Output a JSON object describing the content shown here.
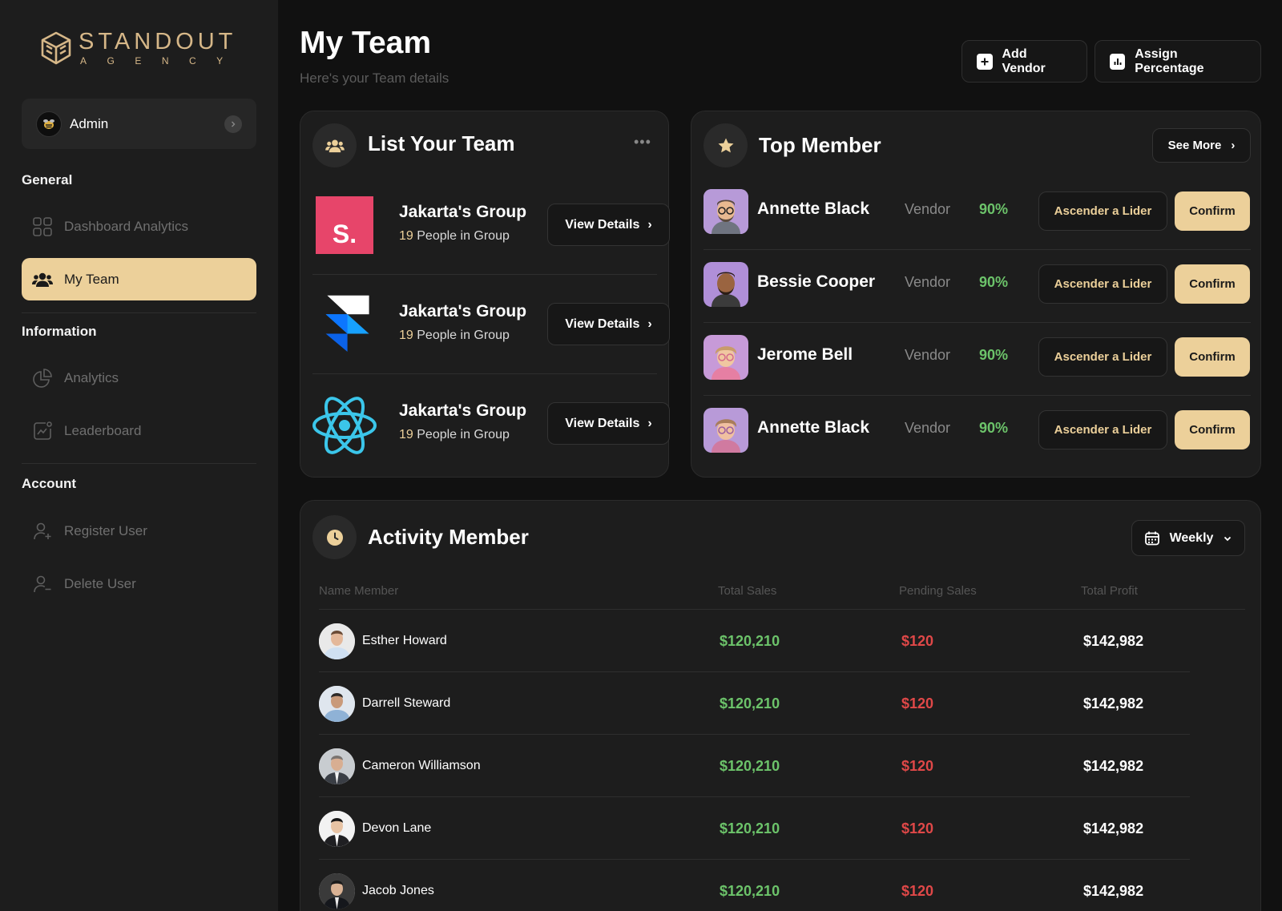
{
  "brand": {
    "title": "STANDOUT",
    "subtitle": "AGENCY",
    "color": "#d6b788"
  },
  "user": {
    "name": "Admin"
  },
  "sidebar": {
    "sections": [
      {
        "label": "General"
      },
      {
        "label": "Information"
      },
      {
        "label": "Account"
      }
    ],
    "items": [
      {
        "label": "Dashboard Analytics",
        "icon": "grid-icon"
      },
      {
        "label": "My Team",
        "icon": "team-icon",
        "active": true
      },
      {
        "label": "Analytics",
        "icon": "pie-chart-icon"
      },
      {
        "label": "Leaderboard",
        "icon": "trend-chart-icon"
      },
      {
        "label": "Register User",
        "icon": "user-add-icon"
      },
      {
        "label": "Delete User",
        "icon": "user-remove-icon"
      }
    ]
  },
  "header": {
    "title": "My Team",
    "subtitle": "Here's your Team details",
    "add_vendor": "Add Vendor",
    "assign_percentage": "Assign Percentage"
  },
  "team_list": {
    "title": "List Your Team",
    "view_details": "View Details",
    "groups": [
      {
        "name": "Jakarta's Group",
        "count": "19",
        "count_suffix": " People in Group",
        "logo": "s-logo",
        "logo_text": "S."
      },
      {
        "name": "Jakarta's Group",
        "count": "19",
        "count_suffix": " People in Group",
        "logo": "framer-logo"
      },
      {
        "name": "Jakarta's Group",
        "count": "19",
        "count_suffix": " People in Group",
        "logo": "react-logo"
      }
    ]
  },
  "top_member": {
    "title": "Top Member",
    "see_more": "See More",
    "ascender_label": "Ascender a Lider",
    "confirm_label": "Confirm",
    "members": [
      {
        "name": "Annette Black",
        "role": "Vendor",
        "percent": "90%"
      },
      {
        "name": "Bessie Cooper",
        "role": "Vendor",
        "percent": "90%"
      },
      {
        "name": "Jerome Bell",
        "role": "Vendor",
        "percent": "90%"
      },
      {
        "name": "Annette Black",
        "role": "Vendor",
        "percent": "90%"
      }
    ]
  },
  "activity": {
    "title": "Activity Member",
    "period": "Weekly",
    "columns": [
      "Name Member",
      "Total Sales",
      "Pending Sales",
      "Total Profit"
    ],
    "rows": [
      {
        "name": "Esther Howard",
        "total_sales": "$120,210",
        "pending": "$120",
        "profit": "$142,982"
      },
      {
        "name": "Darrell Steward",
        "total_sales": "$120,210",
        "pending": "$120",
        "profit": "$142,982"
      },
      {
        "name": "Cameron Williamson",
        "total_sales": "$120,210",
        "pending": "$120",
        "profit": "$142,982"
      },
      {
        "name": "Devon Lane",
        "total_sales": "$120,210",
        "pending": "$120",
        "profit": "$142,982"
      },
      {
        "name": "Jacob Jones",
        "total_sales": "$120,210",
        "pending": "$120",
        "profit": "$142,982"
      }
    ]
  },
  "colors": {
    "accent": "#ecd09a",
    "positive": "#6cc36a",
    "negative": "#e04848",
    "background": "#111111",
    "card": "#1d1d1d"
  }
}
